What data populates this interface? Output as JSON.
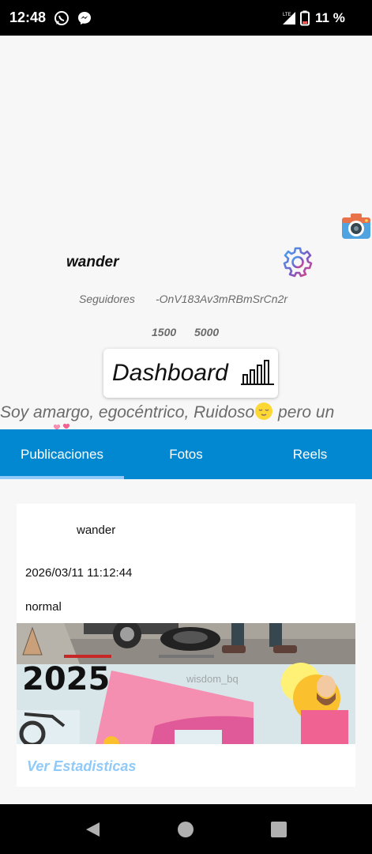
{
  "status_bar": {
    "time": "12:48",
    "battery_percent": "11 %",
    "icons": [
      "whatsapp-icon",
      "messenger-icon",
      "lte-signal-icon",
      "battery-icon"
    ]
  },
  "profile": {
    "username": "wander",
    "followers_label": "Seguidores",
    "user_id": "-OnV183Av3mRBmSrCn2r",
    "count_a": "1500",
    "count_b": "5000",
    "dashboard_label": "Dashboard",
    "bio": "Soy amargo, egocéntrico, Ruidoso",
    "bio_tail": " pero un"
  },
  "tabs": {
    "items": [
      "Publicaciones",
      "Fotos",
      "Reels"
    ],
    "active": "Publicaciones"
  },
  "post": {
    "author": "wander",
    "datetime": "2026/03/11 11:12:44",
    "type": "normal",
    "image_text": "2025",
    "watermark": "wisdom_bq",
    "stats_link": "Ver Estadisticas"
  },
  "colors": {
    "tab_bar": "#0288d1",
    "tab_indicator": "#90caf9",
    "link": "#90caf9",
    "page_bg": "#f7f7f7"
  }
}
